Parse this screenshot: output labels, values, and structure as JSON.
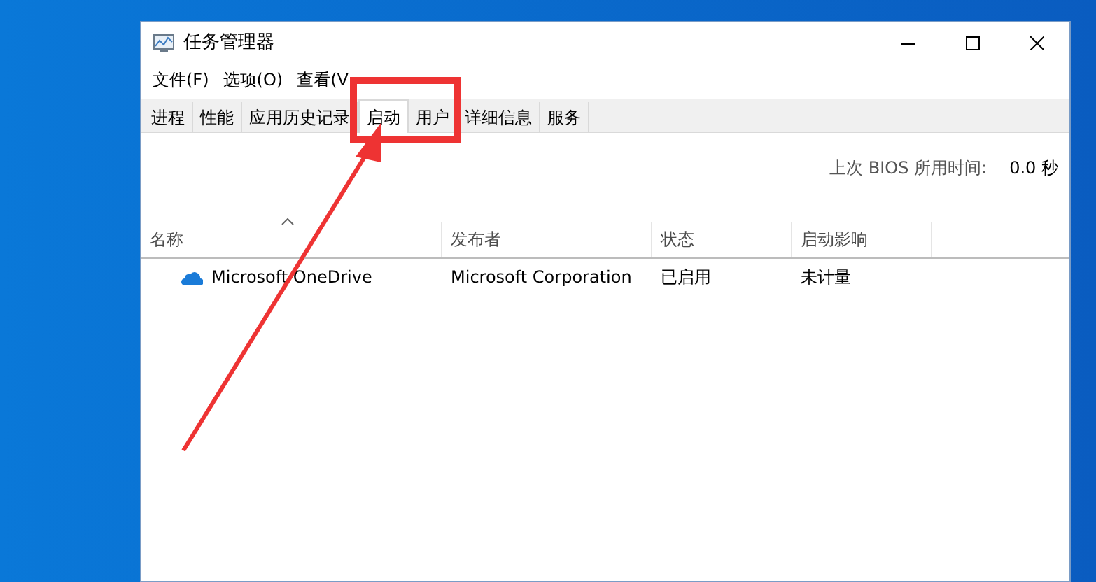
{
  "window": {
    "title": "任务管理器"
  },
  "menu": [
    "文件(F)",
    "选项(O)",
    "查看(V"
  ],
  "tabs": [
    {
      "label": "进程",
      "selected": false
    },
    {
      "label": "性能",
      "selected": false
    },
    {
      "label": "应用历史记录",
      "selected": false
    },
    {
      "label": "启动",
      "selected": true
    },
    {
      "label": "用户",
      "selected": false
    },
    {
      "label": "详细信息",
      "selected": false
    },
    {
      "label": "服务",
      "selected": false
    }
  ],
  "bios": {
    "label": "上次 BIOS 所用时间:",
    "value": "0.0 秒"
  },
  "table": {
    "columns": [
      {
        "label": "名称",
        "sorted": true
      },
      {
        "label": "发布者",
        "sorted": false
      },
      {
        "label": "状态",
        "sorted": false
      },
      {
        "label": "启动影响",
        "sorted": false
      }
    ],
    "rows": [
      {
        "cells": [
          "Microsoft OneDrive",
          "Microsoft Corporation",
          "已启用",
          "未计量"
        ]
      }
    ]
  }
}
